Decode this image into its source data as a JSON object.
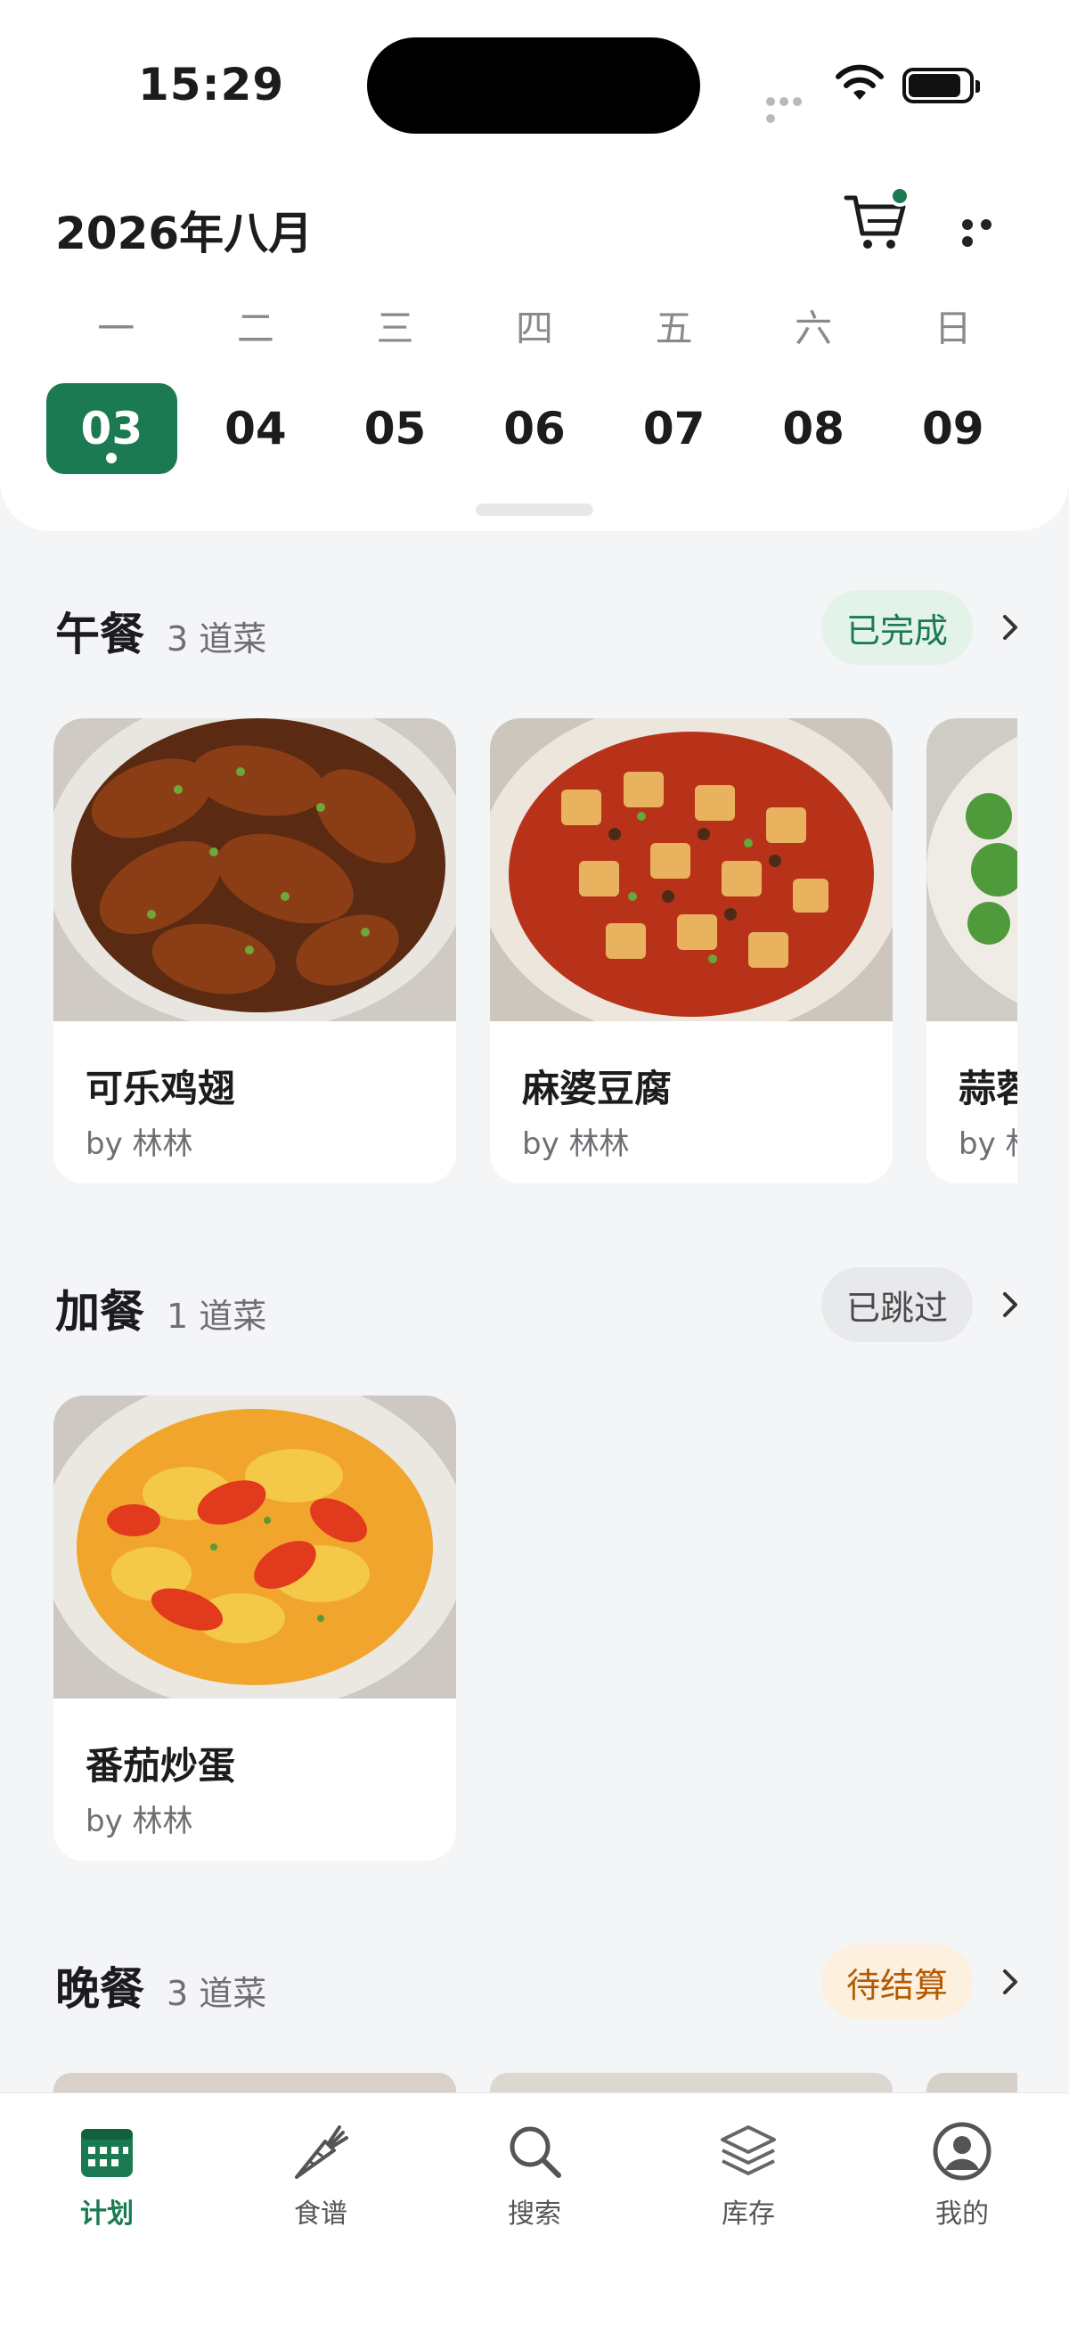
{
  "status_bar": {
    "time": "15:29"
  },
  "header": {
    "month_title": "2026年八月",
    "weekdays": [
      "一",
      "二",
      "三",
      "四",
      "五",
      "六",
      "日"
    ],
    "dates": [
      "03",
      "04",
      "05",
      "06",
      "07",
      "08",
      "09"
    ],
    "selected_date": "03"
  },
  "sections": [
    {
      "title": "午餐",
      "count": "3 道菜",
      "status": "已完成",
      "dishes": [
        {
          "name": "可乐鸡翅",
          "by": "by 林林"
        },
        {
          "name": "麻婆豆腐",
          "by": "by 林林"
        },
        {
          "name": "蒜蓉",
          "by": "by 林"
        }
      ]
    },
    {
      "title": "加餐",
      "count": "1 道菜",
      "status": "已跳过",
      "dishes": [
        {
          "name": "番茄炒蛋",
          "by": "by 林林"
        }
      ]
    },
    {
      "title": "晚餐",
      "count": "3 道菜",
      "status": "待结算",
      "dishes": []
    }
  ],
  "tabbar": {
    "items": [
      {
        "label": "计划",
        "icon": "calendar-icon",
        "active": true
      },
      {
        "label": "食谱",
        "icon": "carrot-icon",
        "active": false
      },
      {
        "label": "搜索",
        "icon": "search-icon",
        "active": false
      },
      {
        "label": "库存",
        "icon": "layers-icon",
        "active": false
      },
      {
        "label": "我的",
        "icon": "profile-icon",
        "active": false
      }
    ]
  },
  "colors": {
    "accent": "#1b7a52",
    "background": "#f4f5f7",
    "done_badge": "#e3f3ea",
    "skip_badge": "#e8e9ea",
    "pending_badge": "#fdf0de"
  }
}
